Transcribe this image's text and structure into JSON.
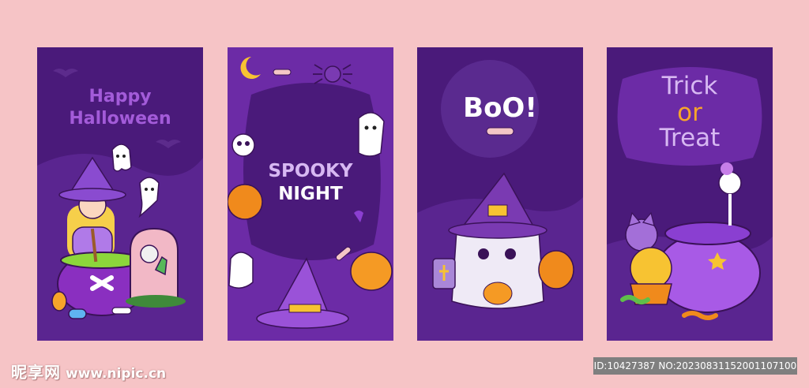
{
  "cards": [
    {
      "title_line1": "Happy",
      "title_line2": "Halloween"
    },
    {
      "title_line1": "SPOOKY",
      "title_line2": "NIGHT"
    },
    {
      "title_line1": "BoO!"
    },
    {
      "title_line1": "Trick",
      "title_line2": "or",
      "title_line3": "Treat"
    }
  ],
  "watermark": {
    "logo": "昵享网",
    "url": "www.nipic.cn",
    "id_text": "ID:10427387 NO:20230831152001107100"
  },
  "colors": {
    "page_bg": "#f6c4c6",
    "card_bg": "#4a1a7a",
    "title_purple": "#a35bd9",
    "title_lilac": "#d7b8f2",
    "title_orange": "#f7a52a"
  }
}
